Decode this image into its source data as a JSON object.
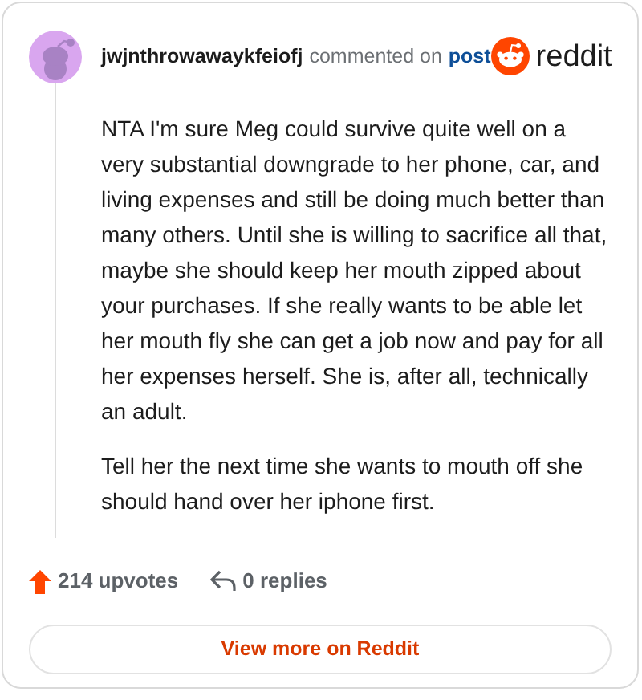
{
  "comment": {
    "author": "jwjnthrowawaykfeiofj",
    "action": "commented on",
    "link": "post",
    "brand": "reddit",
    "paragraphs": [
      "NTA I'm sure Meg could survive quite well on a very substantial downgrade to her phone, car, and living expenses and still be doing much better than many others. Until she is willing to sacrifice all that, maybe she should keep her mouth zipped about your purchases. If she really wants to be able let her mouth fly she can get a job now and pay for all her expenses herself. She is, after all, technically an adult.",
      "Tell her the next time she wants to mouth off she should hand over her iphone first."
    ],
    "upvotes": "214 upvotes",
    "replies": "0 replies"
  },
  "button": "View more on Reddit"
}
